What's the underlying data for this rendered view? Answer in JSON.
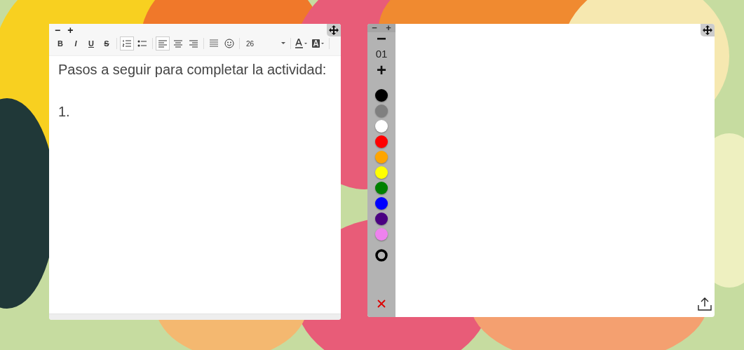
{
  "editor": {
    "zoom_buttons": [
      "−",
      "+"
    ],
    "toolbar": [
      {
        "kind": "bold",
        "label": "B",
        "selected": false
      },
      {
        "kind": "italic",
        "label": "I",
        "selected": false
      },
      {
        "kind": "underline",
        "label": "U",
        "selected": false
      },
      {
        "kind": "strike",
        "label": "S",
        "selected": false
      },
      {
        "kind": "ordered_list",
        "selected": true
      },
      {
        "kind": "bullet_list",
        "selected": false
      },
      {
        "kind": "align_left",
        "selected": true
      },
      {
        "kind": "align_center",
        "selected": false
      },
      {
        "kind": "align_right",
        "selected": false
      },
      {
        "kind": "line_spacing",
        "selected": false
      },
      {
        "kind": "emoji",
        "selected": false
      },
      {
        "kind": "font_size",
        "label": "26",
        "selected": false
      },
      {
        "kind": "font_color",
        "selected": false
      },
      {
        "kind": "highlight",
        "selected": false
      }
    ],
    "lines": [
      "Pasos a seguir para completar la actividad:",
      "1."
    ]
  },
  "drawing": {
    "zoom_buttons": [
      "−",
      "+"
    ],
    "size_down": "−",
    "size": "01",
    "size_up": "+",
    "colors": [
      {
        "color": "#000000",
        "selected": false
      },
      {
        "color": "#808080",
        "selected": false
      },
      {
        "color": "#ffffff",
        "selected": false
      },
      {
        "color": "#ff0000",
        "selected": false
      },
      {
        "color": "#ffa500",
        "selected": false
      },
      {
        "color": "#ffff00",
        "selected": false
      },
      {
        "color": "#008000",
        "selected": false
      },
      {
        "color": "#0000ff",
        "selected": false
      },
      {
        "color": "#4b0082",
        "selected": false
      },
      {
        "color": "#ee82ee",
        "selected": false
      }
    ]
  }
}
